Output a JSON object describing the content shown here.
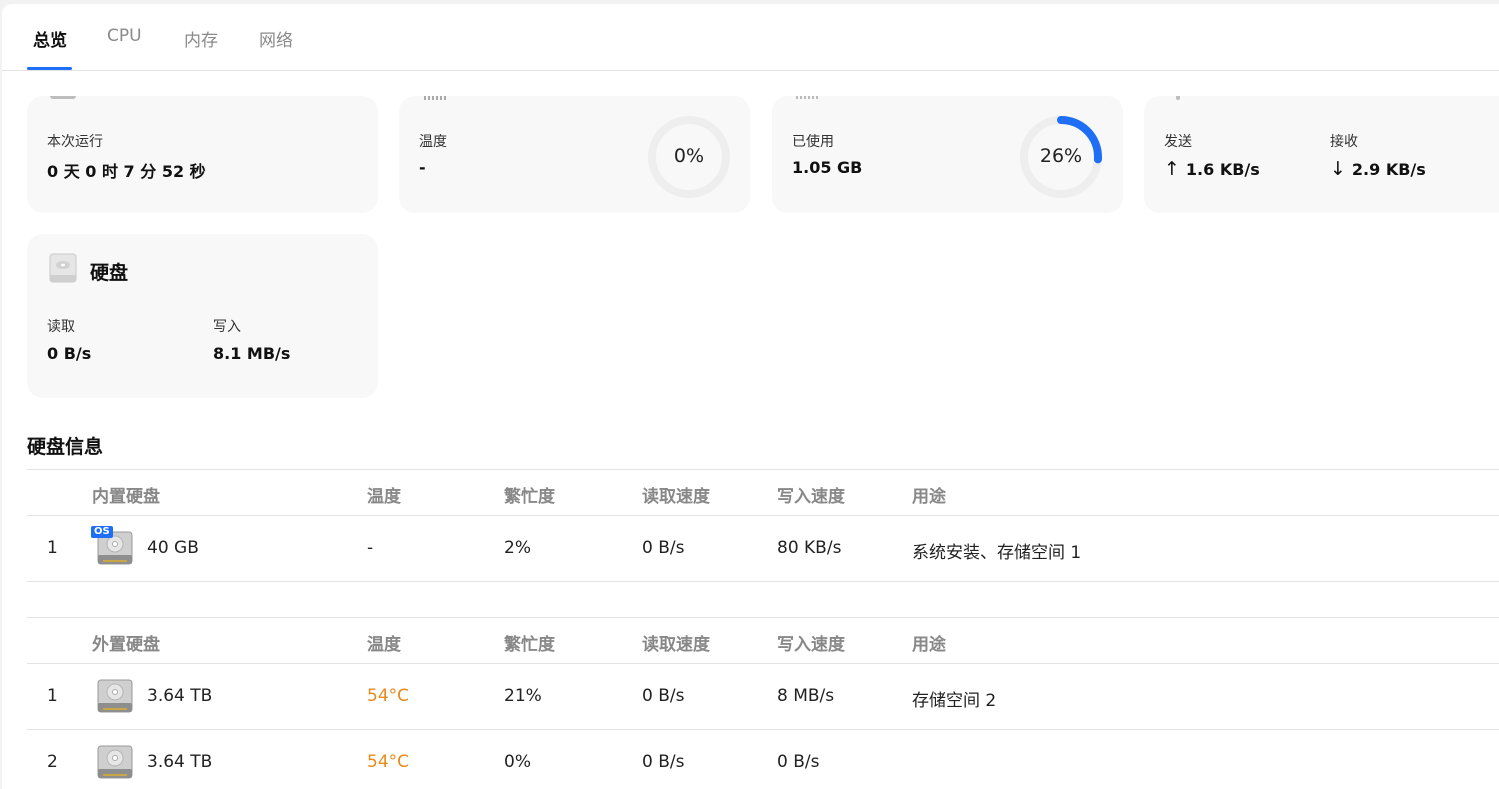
{
  "tabs": [
    {
      "label": "总览",
      "active": true
    },
    {
      "label": "CPU",
      "active": false
    },
    {
      "label": "内存",
      "active": false
    },
    {
      "label": "网络",
      "active": false
    }
  ],
  "uptime_card": {
    "label": "本次运行",
    "value": "0 天 0 时 7 分 52 秒"
  },
  "cpu_card": {
    "temp_label": "温度",
    "temp_value": "-",
    "usage_text": "0%",
    "usage_fraction": 0.0
  },
  "memory_card": {
    "used_label": "已使用",
    "used_value": "1.05 GB",
    "usage_text": "26%",
    "usage_fraction": 0.26
  },
  "network_card": {
    "send_label": "发送",
    "send_arrow": "↑",
    "send_value": "1.6 KB/s",
    "recv_label": "接收",
    "recv_arrow": "↓",
    "recv_value": "2.9 KB/s"
  },
  "disk_card": {
    "title": "硬盘",
    "read_label": "读取",
    "read_value": "0 B/s",
    "write_label": "写入",
    "write_value": "8.1 MB/s"
  },
  "disk_info": {
    "title": "硬盘信息",
    "internal": {
      "headers": [
        "内置硬盘",
        "温度",
        "繁忙度",
        "读取速度",
        "写入速度",
        "用途"
      ],
      "os_badge": "OS",
      "rows": [
        {
          "index": "1",
          "size": "40 GB",
          "temp": "-",
          "busy": "2%",
          "read": "0 B/s",
          "write": "80 KB/s",
          "usage": "系统安装、存储空间 1"
        }
      ]
    },
    "external": {
      "headers": [
        "外置硬盘",
        "温度",
        "繁忙度",
        "读取速度",
        "写入速度",
        "用途"
      ],
      "rows": [
        {
          "index": "1",
          "size": "3.64 TB",
          "temp": "54°C",
          "busy": "21%",
          "read": "0 B/s",
          "write": "8 MB/s",
          "usage": "存储空间 2"
        },
        {
          "index": "2",
          "size": "3.64 TB",
          "temp": "54°C",
          "busy": "0%",
          "read": "0 B/s",
          "write": "0 B/s",
          "usage": ""
        }
      ]
    }
  },
  "colors": {
    "accent": "#1e6ff5",
    "warning": "#e88a1a",
    "ring_track": "#eeeeee"
  }
}
